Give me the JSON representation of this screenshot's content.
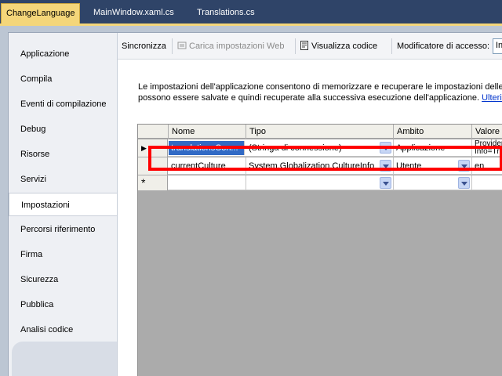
{
  "tabs": [
    {
      "label": "ChangeLanguage",
      "active": true
    },
    {
      "label": "MainWindow.xaml.cs",
      "active": false
    },
    {
      "label": "Translations.cs",
      "active": false
    }
  ],
  "nav": {
    "items": [
      {
        "label": "Applicazione"
      },
      {
        "label": "Compila"
      },
      {
        "label": "Eventi di compilazione"
      },
      {
        "label": "Debug"
      },
      {
        "label": "Risorse"
      },
      {
        "label": "Servizi"
      },
      {
        "label": "Impostazioni",
        "selected": true
      },
      {
        "label": "Percorsi riferimento"
      },
      {
        "label": "Firma"
      },
      {
        "label": "Sicurezza"
      },
      {
        "label": "Pubblica"
      },
      {
        "label": "Analisi codice"
      }
    ]
  },
  "toolbar": {
    "sync_label": "Sincronizza",
    "load_web_label": "Carica impostazioni Web",
    "view_code_label": "Visualizza codice",
    "access_modifier_label": "Modificatore di accesso:",
    "access_modifier_value": "Inte"
  },
  "description": {
    "line1": "Le impostazioni dell'applicazione consentono di memorizzare e recuperare le impostazioni delle pr",
    "line2": "possono essere salvate e quindi recuperate alla successiva esecuzione dell'applicazione.",
    "link": "Ulterio"
  },
  "grid": {
    "columns": [
      "Nome",
      "Tipo",
      "Ambito",
      "Valore"
    ],
    "rows": [
      {
        "marker": "▶",
        "name": "translationsCon...",
        "type": "(Stringa di connessione)",
        "scope": "Applicazione",
        "value_line1": "Provider=",
        "value_line2": "Info=True"
      },
      {
        "marker": "",
        "name": "currentCulture",
        "type": "System.Globalization.CultureInfo",
        "scope": "Utente",
        "value": "en"
      },
      {
        "marker": "*",
        "name": "",
        "type": "",
        "scope": "",
        "value": ""
      }
    ]
  },
  "colors": {
    "tab_active": "#f4d67a",
    "selection": "#316ac5",
    "highlight": "#ff0000"
  }
}
